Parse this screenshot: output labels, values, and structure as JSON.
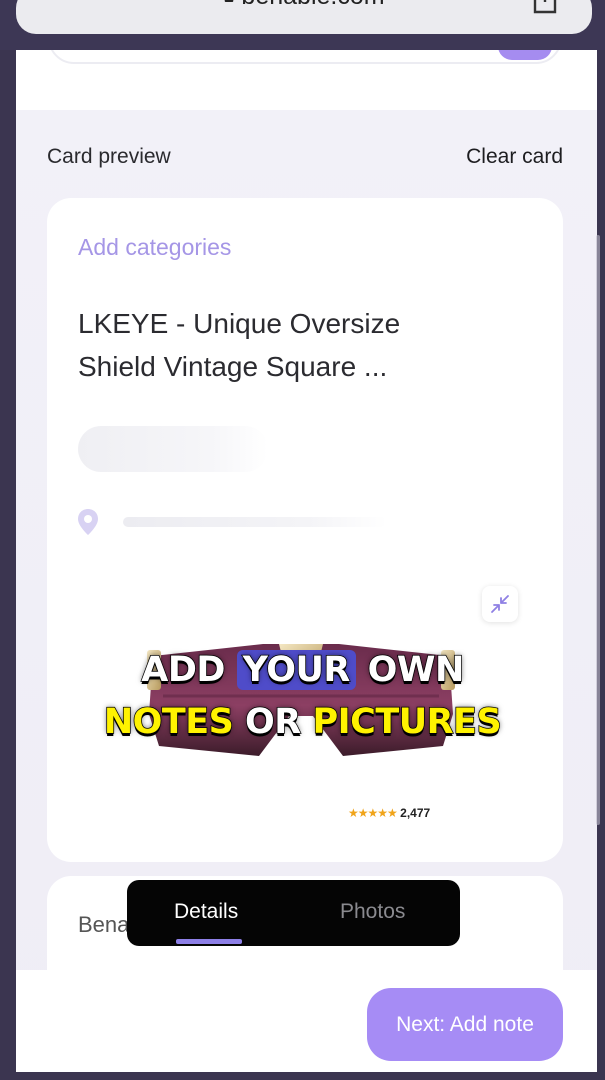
{
  "browser": {
    "url": "benable.com"
  },
  "header": {
    "section_label": "Card preview",
    "clear_label": "Clear card"
  },
  "card": {
    "add_categories": "Add categories",
    "title_line1": "LKEYE - Unique Oversize",
    "title_line2": "Shield Vintage Square ..."
  },
  "overlay": {
    "line1_pre": "ADD",
    "line1_hl": "YOUR",
    "line1_post": "OWN",
    "line2_a": "NOTES",
    "line2_b": "OR",
    "line2_c": "PICTURES"
  },
  "product": {
    "stars": "★★★★★",
    "review_count": "2,477"
  },
  "card2": {
    "label": "Bena"
  },
  "tabs": [
    {
      "label": "Details",
      "active": true
    },
    {
      "label": "Photos",
      "active": false
    }
  ],
  "footer": {
    "next_label": "Next: Add note"
  },
  "colors": {
    "accent": "#a68cf5",
    "highlight": "#4f4cc9",
    "caption_yellow": "#fff200"
  }
}
